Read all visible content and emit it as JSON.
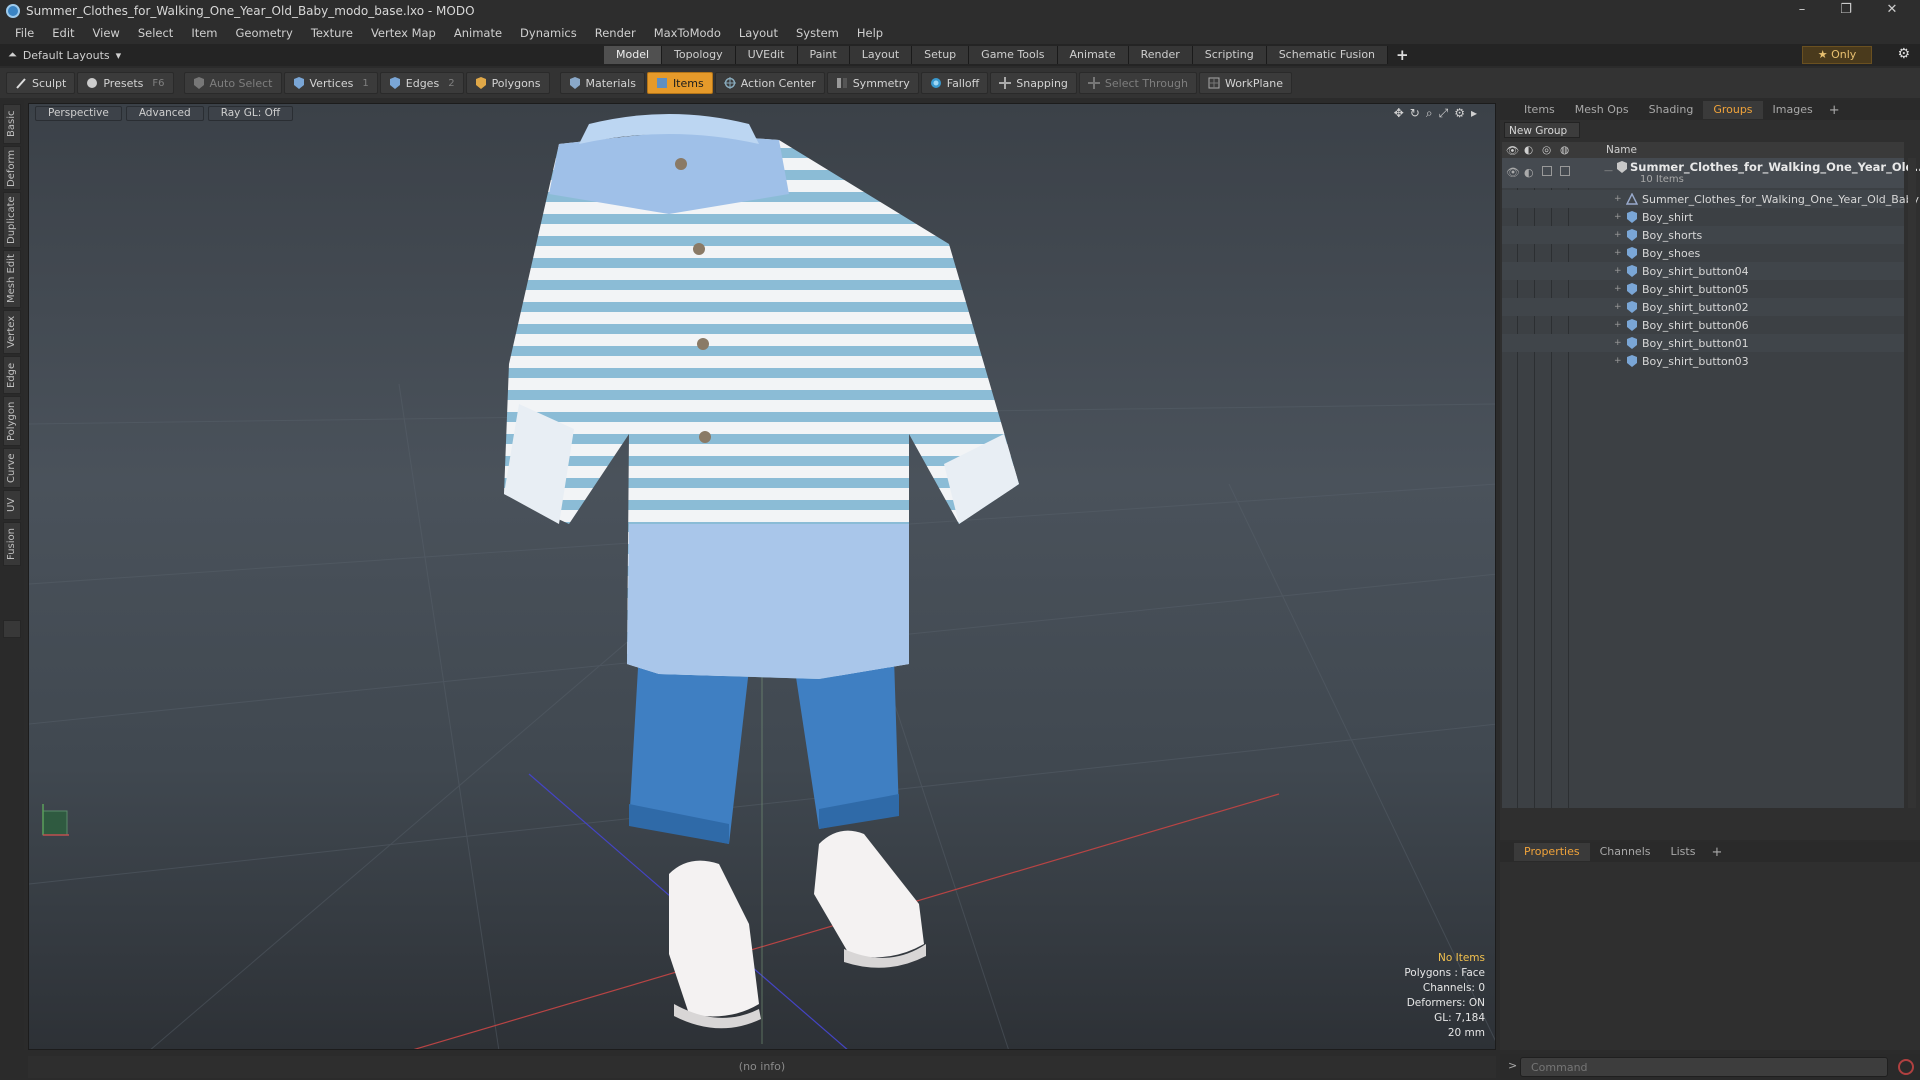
{
  "window": {
    "title": "Summer_Clothes_for_Walking_One_Year_Old_Baby_modo_base.lxo - MODO",
    "minimize": "–",
    "restore": "❐",
    "close": "✕"
  },
  "menubar": [
    "File",
    "Edit",
    "View",
    "Select",
    "Item",
    "Geometry",
    "Texture",
    "Vertex Map",
    "Animate",
    "Dynamics",
    "Render",
    "MaxToModo",
    "Layout",
    "System",
    "Help"
  ],
  "layoutbar": {
    "layout_label": "Default Layouts",
    "tabs": [
      "Model",
      "Topology",
      "UVEdit",
      "Paint",
      "Layout",
      "Setup",
      "Game Tools",
      "Animate",
      "Render",
      "Scripting",
      "Schematic Fusion"
    ],
    "active_tab": "Model",
    "add_tab": "+",
    "only_label": "★  Only"
  },
  "toolbar": {
    "sculpt": "Sculpt",
    "presets": "Presets",
    "presets_hotkey": "F6",
    "auto_select": "Auto Select",
    "vertices": "Vertices",
    "vertices_hotkey": "1",
    "edges": "Edges",
    "edges_hotkey": "2",
    "polygons": "Polygons",
    "materials": "Materials",
    "items": "Items",
    "action_center": "Action Center",
    "symmetry": "Symmetry",
    "falloff": "Falloff",
    "snapping": "Snapping",
    "select_through": "Select Through",
    "workplane": "WorkPlane"
  },
  "left_tabs": [
    "Basic",
    "Deform",
    "Duplicate",
    "Mesh Edit",
    "Vertex",
    "Edge",
    "Polygon",
    "Curve",
    "UV",
    "Fusion"
  ],
  "viewport": {
    "view_mode": "Perspective",
    "shading": "Advanced",
    "raygl": "Ray GL: Off",
    "info": {
      "selection": "No Items",
      "polygons": "Polygons : Face",
      "channels": "Channels: 0",
      "deformers": "Deformers: ON",
      "gl": "GL: 7,184",
      "grid": "20 mm"
    }
  },
  "groups_panel": {
    "tabs": [
      "Items",
      "Mesh Ops",
      "Shading",
      "Groups",
      "Images"
    ],
    "active_tab": "Groups",
    "add_tab": "+",
    "new_group": "New Group",
    "column_name": "Name",
    "group_title": "Summer_Clothes_for_Walking_One_Year_Old...",
    "group_count": "10 Items",
    "items": [
      "Summer_Clothes_for_Walking_One_Year_Old_Baby",
      "Boy_shirt",
      "Boy_shorts",
      "Boy_shoes",
      "Boy_shirt_button04",
      "Boy_shirt_button05",
      "Boy_shirt_button02",
      "Boy_shirt_button06",
      "Boy_shirt_button01",
      "Boy_shirt_button03"
    ]
  },
  "properties_panel": {
    "tabs": [
      "Properties",
      "Channels",
      "Lists"
    ],
    "active_tab": "Properties",
    "add_tab": "+"
  },
  "statusbar": {
    "info": "(no info)"
  },
  "command": {
    "prompt": ">",
    "placeholder": "Command"
  },
  "colors": {
    "accent": "#e69a2a",
    "active_tab_text": "#f0a33a",
    "viewport_top": "#3b4148",
    "viewport_bottom": "#2d3136"
  }
}
